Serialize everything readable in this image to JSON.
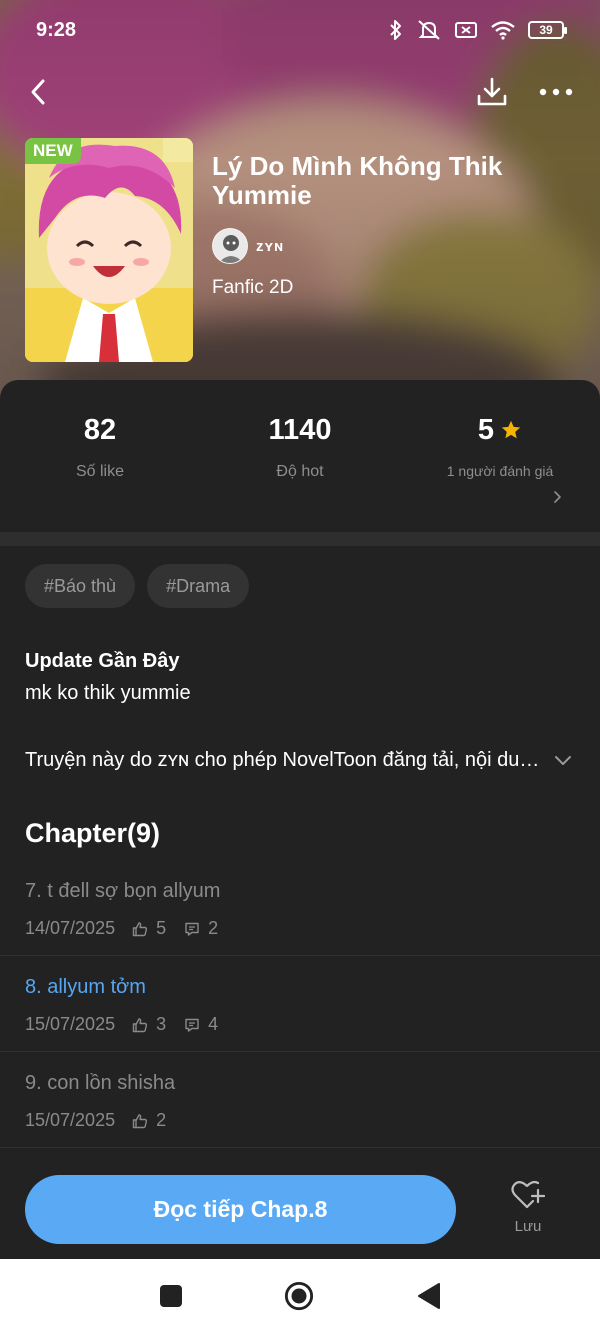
{
  "status_bar": {
    "time": "9:28",
    "battery": "39",
    "icons": [
      "bluetooth-icon",
      "mute-vibrate-icon",
      "no-sim-icon",
      "wifi-icon",
      "battery-icon"
    ]
  },
  "nav": {
    "icons": [
      "back-arrow-icon",
      "download-icon",
      "more-dots-icon"
    ]
  },
  "book": {
    "badge": "NEW",
    "title": "Lý Do Mình Không Thik Yummie",
    "author": "ᴢʏɴ",
    "genre": "Fanfic 2D"
  },
  "stats": {
    "likes_value": "82",
    "likes_label": "Số like",
    "hot_value": "1140",
    "hot_label": "Độ hot",
    "rating_value": "5",
    "rating_label": "1 người đánh giá"
  },
  "tags": [
    "#Báo thù",
    "#Drama"
  ],
  "update": {
    "heading": "Update Gần Đây",
    "text": "mk ko thik yummie"
  },
  "notice": {
    "text": "Truyện này do ᴢʏɴ cho phép NovelToon đăng tải, nội dung truyện thuộc quyền sở hữu của tác giả"
  },
  "chapters": {
    "heading": "Chapter(9)",
    "items": [
      {
        "title": "7. t đell sợ bọn allyum",
        "date": "14/07/2025",
        "likes": "5",
        "comments": "2",
        "current": false
      },
      {
        "title": "8. allyum tởm",
        "date": "15/07/2025",
        "likes": "3",
        "comments": "4",
        "current": true
      },
      {
        "title": "9. con lồn shisha",
        "date": "15/07/2025",
        "likes": "2",
        "comments": "",
        "current": false
      }
    ]
  },
  "bottom": {
    "read_label": "Đọc tiếp Chap.8",
    "save_label": "Lưu"
  },
  "colors": {
    "accent": "#5aa9f5",
    "badge": "#79c342",
    "star": "#f5b400",
    "background": "#222222"
  }
}
